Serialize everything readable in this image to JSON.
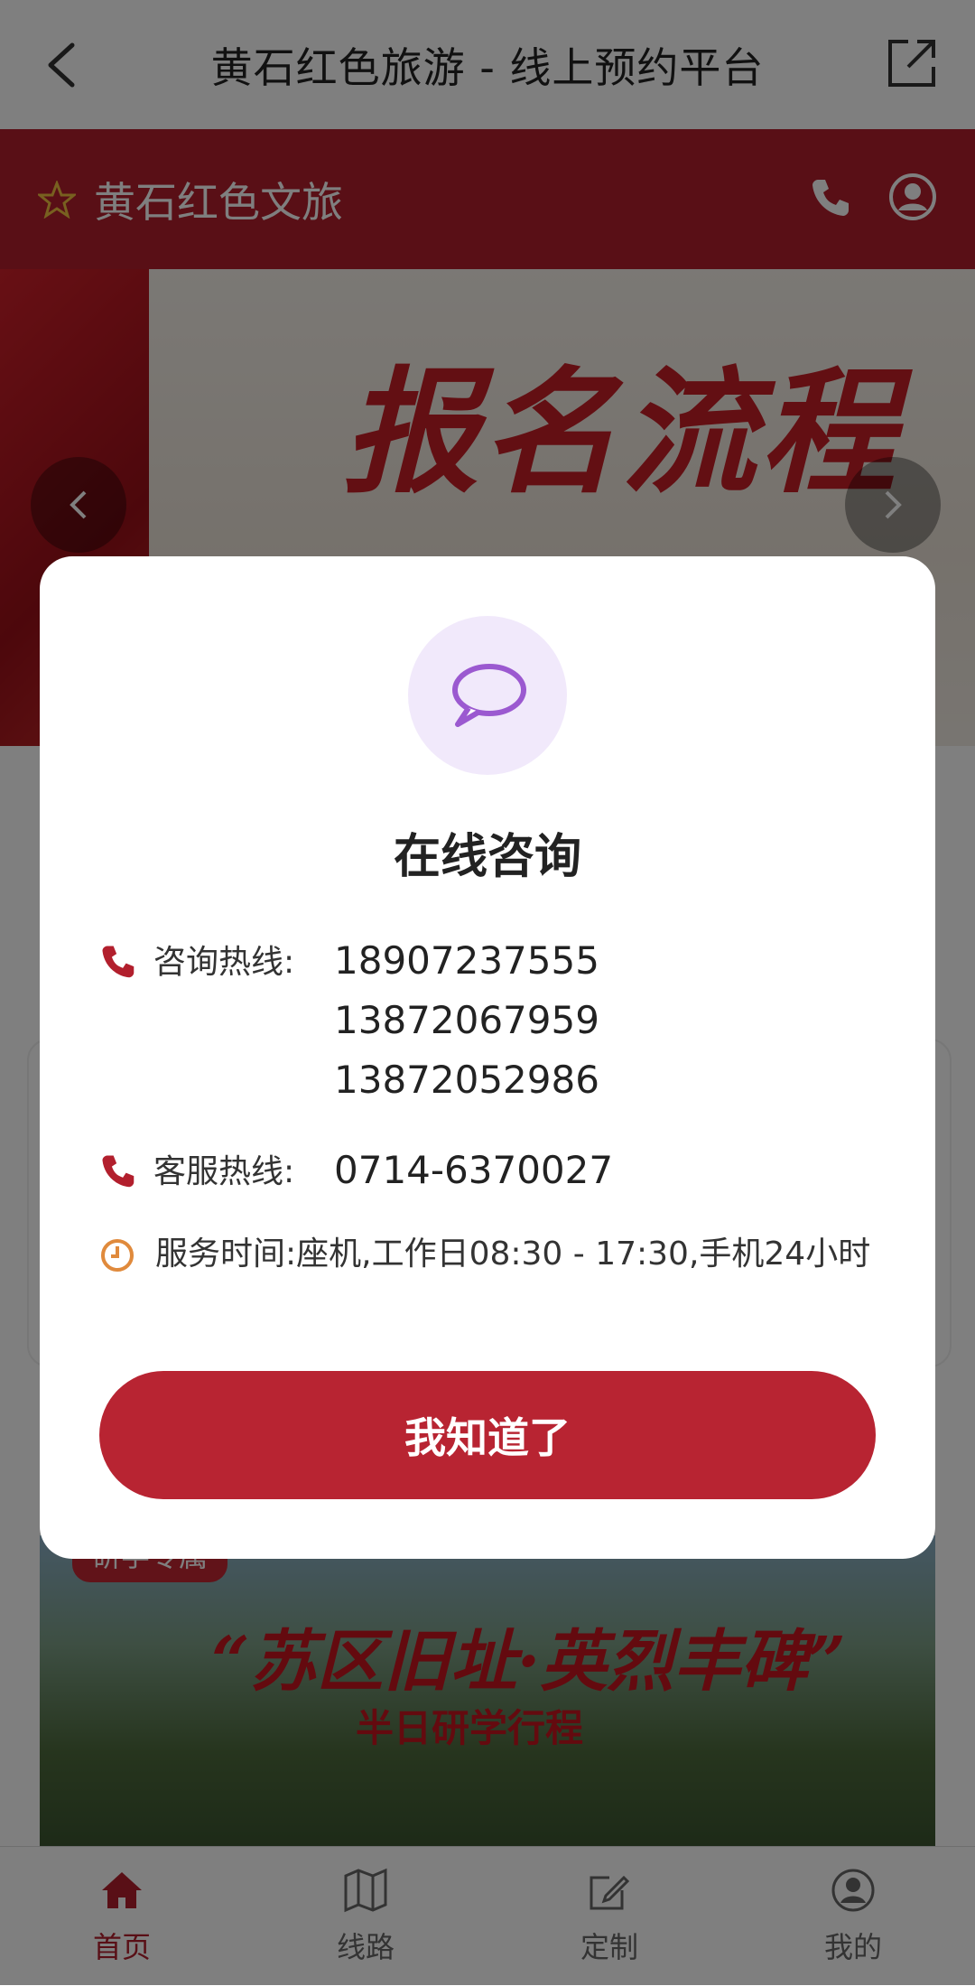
{
  "topbar": {
    "title": "黄石红色旅游 - 线上预约平台"
  },
  "header": {
    "brand": "黄石红色文旅"
  },
  "banner": {
    "text": "报名流程"
  },
  "tour": {
    "tag": "研学专属",
    "title": "“苏区旧址·英烈丰碑”",
    "subtitle": "半日研学行程"
  },
  "tabs": [
    {
      "label": "首页",
      "icon": "home-icon",
      "active": true
    },
    {
      "label": "线路",
      "icon": "map-icon",
      "active": false
    },
    {
      "label": "定制",
      "icon": "edit-icon",
      "active": false
    },
    {
      "label": "我的",
      "icon": "user-icon",
      "active": false
    }
  ],
  "modal": {
    "title": "在线咨询",
    "consult_label": "咨询热线:",
    "consult_numbers": [
      "18907237555",
      "13872067959",
      "13872052986"
    ],
    "service_label": "客服热线:",
    "service_number": "0714-6370027",
    "hours": "服务时间:座机,工作日08:30 - 17:30,手机24小时",
    "button": "我知道了"
  },
  "colors": {
    "brand": "#b21f2d",
    "accent_purple": "#9b59d0",
    "clock_orange": "#e08a3c"
  }
}
